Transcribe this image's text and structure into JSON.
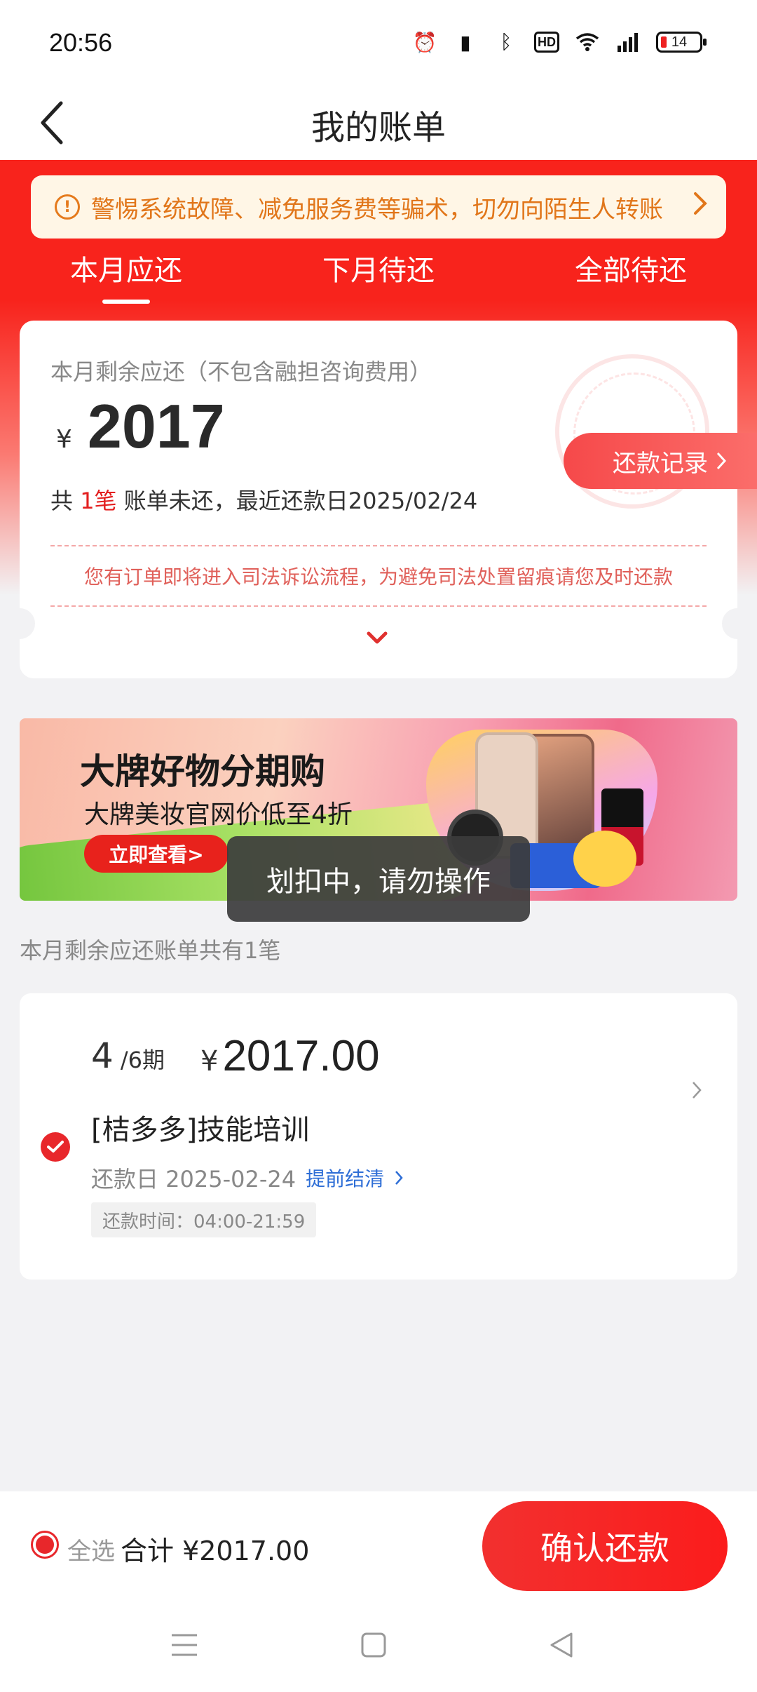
{
  "status": {
    "time": "20:56",
    "hd": "HD",
    "battery": "14"
  },
  "nav": {
    "title": "我的账单"
  },
  "notice": {
    "text": "警惕系统故障、减免服务费等骗术，切勿向陌生人转账",
    "icon": "!"
  },
  "tabs": [
    "本月应还",
    "下月待还",
    "全部待还"
  ],
  "summary": {
    "subtitle": "本月剩余应还（不包含融担咨询费用）",
    "currency": "¥",
    "amount": "2017",
    "line_prefix": "共 ",
    "count": "1笔",
    "line_suffix": " 账单未还，最近还款日2025/02/24",
    "record_button": "还款记录",
    "warning": "您有订单即将进入司法诉讼流程，为避免司法处置留痕请您及时还款"
  },
  "banner": {
    "title": "大牌好物分期购",
    "subtitle": "大牌美妆官网价低至4折",
    "button": "立即查看>"
  },
  "toast": "划扣中，请勿操作",
  "section_label": "本月剩余应还账单共有1笔",
  "bill": {
    "period_num": "4",
    "period_total": "/6期",
    "currency": "¥",
    "amount": "2017.00",
    "name": "[桔多多]技能培训",
    "due_date": "还款日 2025-02-24",
    "prepay": "提前结清",
    "pay_time": "还款时间：04:00-21:59"
  },
  "bottom": {
    "select_all": "全选",
    "total": "合计 ¥2017.00",
    "confirm": "确认还款"
  },
  "colors": {
    "brand_red": "#f8231c",
    "notice_orange": "#e1761a",
    "link_blue": "#2e6ed6"
  }
}
